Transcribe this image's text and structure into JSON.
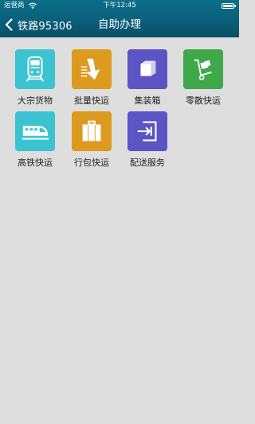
{
  "status_bar": {
    "carrier": "运营商",
    "time": "下午12:45"
  },
  "nav": {
    "back_label": "铁路95306",
    "title": "自助办理"
  },
  "services": [
    {
      "label": "大宗货物",
      "icon": "train-front-icon",
      "color": "#3bc3d1"
    },
    {
      "label": "批量快运",
      "icon": "download-arrow-icon",
      "color": "#dc9a1f"
    },
    {
      "label": "集装箱",
      "icon": "container-box-icon",
      "color": "#5b54c4"
    },
    {
      "label": "零散快运",
      "icon": "hand-truck-icon",
      "color": "#3fa84a"
    },
    {
      "label": "高铁快运",
      "icon": "high-speed-train-icon",
      "color": "#3bc3d1"
    },
    {
      "label": "行包快运",
      "icon": "luggage-icon",
      "color": "#dc9a1f"
    },
    {
      "label": "配送服务",
      "icon": "delivery-login-icon",
      "color": "#5b54c4"
    }
  ]
}
